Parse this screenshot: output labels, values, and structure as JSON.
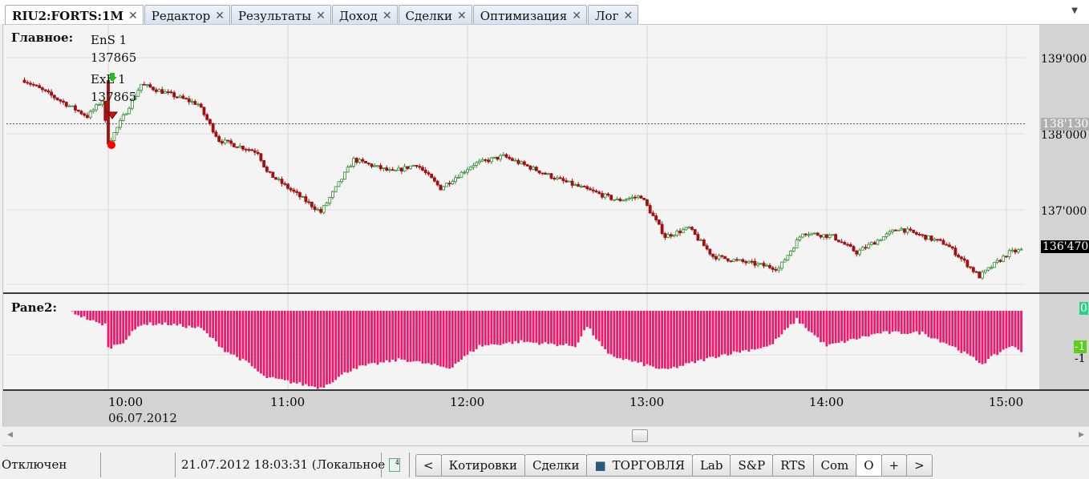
{
  "tabs": [
    {
      "label": "RIU2:FORTS:1M",
      "active": true
    },
    {
      "label": "Редактор"
    },
    {
      "label": "Результаты"
    },
    {
      "label": "Доход"
    },
    {
      "label": "Сделки"
    },
    {
      "label": "Оптимизация"
    },
    {
      "label": "Лог"
    }
  ],
  "main_pane": {
    "title": "Главное:",
    "entry_label": "EnS 1",
    "entry_price": "137865",
    "exit_label": "ExL 1",
    "exit_price": "137865",
    "last_price": "136'470",
    "marker_price": "138'130"
  },
  "pane2": {
    "title": "Pane2:",
    "zero_label": "0",
    "neg_label": "-1",
    "neg_tick": "-1"
  },
  "date_label": "06.07.2012",
  "status": {
    "connection": "Отключен",
    "datetime": "21.07.2012 18:03:31 (Локальное"
  },
  "bottom_tabs": {
    "prev": "<",
    "items": [
      "Котировки",
      "Сделки",
      "ТОРГОВЛЯ",
      "Lab",
      "S&P",
      "RTS",
      "Com",
      "O"
    ],
    "add": "+",
    "next": ">"
  },
  "colors": {
    "up": "#2e8b2e",
    "down": "#a01010",
    "hist": "#f0186a"
  },
  "chart_data": [
    {
      "type": "candlestick",
      "title": "RIU2:FORTS:1M",
      "y_ticks": [
        "139'000",
        "138'000",
        "137'000"
      ],
      "y_tick_values": [
        139000,
        138000,
        137000
      ],
      "x_ticks": [
        "10:00",
        "11:00",
        "12:00",
        "13:00",
        "14:00",
        "15:00"
      ],
      "close_path": [
        [
          "09:32",
          138705
        ],
        [
          "09:53",
          138230
        ],
        [
          "09:58",
          138440
        ],
        [
          "10:00",
          137865
        ],
        [
          "10:11",
          138650
        ],
        [
          "10:30",
          138390
        ],
        [
          "10:37",
          137915
        ],
        [
          "10:50",
          137760
        ],
        [
          "10:53",
          137495
        ],
        [
          "11:11",
          136970
        ],
        [
          "11:22",
          137660
        ],
        [
          "11:35",
          137495
        ],
        [
          "11:43",
          137600
        ],
        [
          "11:51",
          137285
        ],
        [
          "12:02",
          137600
        ],
        [
          "12:12",
          137705
        ],
        [
          "12:31",
          137390
        ],
        [
          "12:50",
          137125
        ],
        [
          "12:58",
          137180
        ],
        [
          "13:06",
          136650
        ],
        [
          "13:14",
          136760
        ],
        [
          "13:22",
          136390
        ],
        [
          "13:44",
          136230
        ],
        [
          "13:52",
          136705
        ],
        [
          "14:02",
          136650
        ],
        [
          "14:10",
          136440
        ],
        [
          "14:24",
          136760
        ],
        [
          "14:40",
          136550
        ],
        [
          "14:51",
          136125
        ],
        [
          "15:01",
          136440
        ],
        [
          "15:05",
          136470
        ]
      ],
      "ylim": [
        135900,
        139350
      ],
      "hline": 138130
    },
    {
      "type": "bar",
      "title": "Pane2",
      "ylim": [
        -1.8,
        0.1
      ],
      "path": [
        [
          "09:47",
          0
        ],
        [
          "09:57",
          -0.3
        ],
        [
          "09:59",
          -0.3
        ],
        [
          "10:00",
          -0.85
        ],
        [
          "10:05",
          -0.7
        ],
        [
          "10:11",
          -0.3
        ],
        [
          "10:20",
          -0.3
        ],
        [
          "10:31",
          -0.4
        ],
        [
          "10:39",
          -0.9
        ],
        [
          "10:47",
          -1.2
        ],
        [
          "10:52",
          -1.5
        ],
        [
          "11:11",
          -1.75
        ],
        [
          "11:22",
          -1.3
        ],
        [
          "11:38",
          -1.1
        ],
        [
          "11:54",
          -1.3
        ],
        [
          "12:04",
          -0.8
        ],
        [
          "12:18",
          -0.7
        ],
        [
          "12:36",
          -0.8
        ],
        [
          "12:40",
          -0.35
        ],
        [
          "12:47",
          -1.0
        ],
        [
          "13:06",
          -1.35
        ],
        [
          "13:25",
          -1.0
        ],
        [
          "13:41",
          -0.8
        ],
        [
          "13:50",
          -0.2
        ],
        [
          "13:60",
          -0.8
        ],
        [
          "14:18",
          -0.5
        ],
        [
          "14:32",
          -0.5
        ],
        [
          "14:42",
          -0.8
        ],
        [
          "14:52",
          -1.2
        ],
        [
          "15:01",
          -0.8
        ],
        [
          "15:05",
          -0.9
        ]
      ]
    }
  ]
}
